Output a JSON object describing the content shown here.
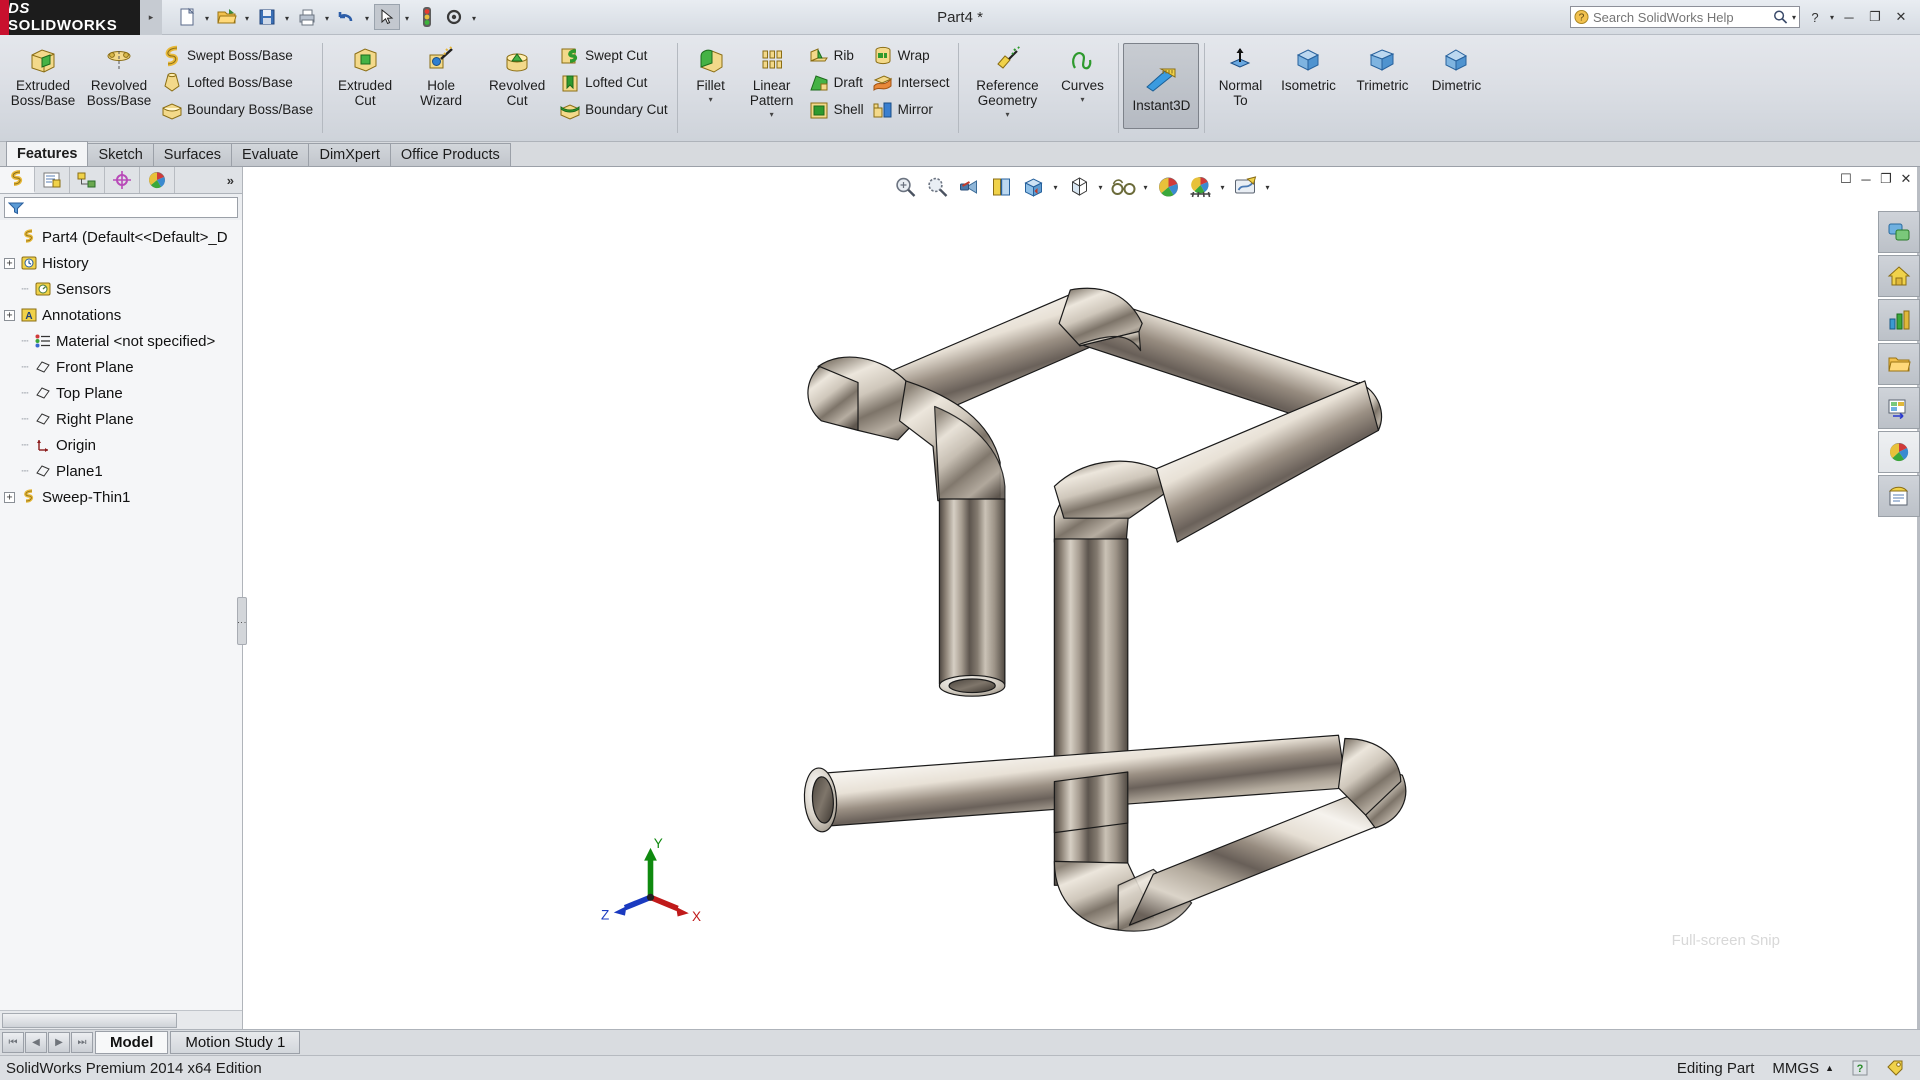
{
  "app": {
    "logo_text_ds": "DS",
    "logo_text_name": "SOLIDWORKS",
    "title": "Part4 *"
  },
  "quick_access": {
    "buttons": [
      {
        "name": "new-document",
        "icon": "new-file-icon"
      },
      {
        "name": "open-document",
        "icon": "open-folder-icon"
      },
      {
        "name": "save-document",
        "icon": "save-disk-icon"
      },
      {
        "name": "print-document",
        "icon": "printer-icon"
      },
      {
        "name": "undo",
        "icon": "undo-arrow-icon"
      },
      {
        "name": "select",
        "icon": "cursor-arrow-icon"
      },
      {
        "name": "rebuild",
        "icon": "traffic-light-icon"
      },
      {
        "name": "options",
        "icon": "gear-icon"
      }
    ]
  },
  "search": {
    "placeholder": "Search SolidWorks Help",
    "value": ""
  },
  "window_controls": {
    "help": "?",
    "minimize": "─",
    "restore": "❐",
    "close": "✕"
  },
  "ribbon": {
    "groups": [
      {
        "name": "boss-base",
        "big": [
          {
            "label": "Extruded\nBoss/Base",
            "icon": "extruded-boss-icon"
          },
          {
            "label": "Revolved\nBoss/Base",
            "icon": "revolved-boss-icon"
          }
        ],
        "small": [
          {
            "label": "Swept Boss/Base",
            "icon": "swept-boss-icon"
          },
          {
            "label": "Lofted Boss/Base",
            "icon": "lofted-boss-icon"
          },
          {
            "label": "Boundary Boss/Base",
            "icon": "boundary-boss-icon"
          }
        ]
      },
      {
        "name": "cut",
        "big": [
          {
            "label": "Extruded\nCut",
            "icon": "extruded-cut-icon"
          },
          {
            "label": "Hole\nWizard",
            "icon": "hole-wizard-icon"
          },
          {
            "label": "Revolved\nCut",
            "icon": "revolved-cut-icon"
          }
        ],
        "small": [
          {
            "label": "Swept Cut",
            "icon": "swept-cut-icon"
          },
          {
            "label": "Lofted Cut",
            "icon": "lofted-cut-icon"
          },
          {
            "label": "Boundary Cut",
            "icon": "boundary-cut-icon"
          }
        ]
      },
      {
        "name": "features",
        "big": [
          {
            "label": "Fillet",
            "icon": "fillet-icon",
            "caret": true
          },
          {
            "label": "Linear\nPattern",
            "icon": "linear-pattern-icon",
            "caret": true
          }
        ],
        "small": [
          {
            "label": "Rib",
            "icon": "rib-icon"
          },
          {
            "label": "Draft",
            "icon": "draft-icon"
          },
          {
            "label": "Shell",
            "icon": "shell-icon"
          }
        ],
        "small2": [
          {
            "label": "Wrap",
            "icon": "wrap-icon"
          },
          {
            "label": "Intersect",
            "icon": "intersect-icon"
          },
          {
            "label": "Mirror",
            "icon": "mirror-icon"
          }
        ]
      },
      {
        "name": "reference",
        "big": [
          {
            "label": "Reference\nGeometry",
            "icon": "reference-geometry-icon",
            "caret": true
          },
          {
            "label": "Curves",
            "icon": "curves-icon",
            "caret": true
          }
        ]
      },
      {
        "name": "instant3d",
        "big": [
          {
            "label": "Instant3D",
            "icon": "instant3d-icon",
            "selected": true
          }
        ]
      },
      {
        "name": "view-orientation",
        "big": [
          {
            "label": "Normal\nTo",
            "icon": "normal-to-icon"
          },
          {
            "label": "Isometric",
            "icon": "isometric-cube-icon"
          },
          {
            "label": "Trimetric",
            "icon": "trimetric-cube-icon"
          },
          {
            "label": "Dimetric",
            "icon": "dimetric-cube-icon"
          }
        ]
      }
    ]
  },
  "command_tabs": [
    {
      "label": "Features",
      "active": true
    },
    {
      "label": "Sketch",
      "active": false
    },
    {
      "label": "Surfaces",
      "active": false
    },
    {
      "label": "Evaluate",
      "active": false
    },
    {
      "label": "DimXpert",
      "active": false
    },
    {
      "label": "Office Products",
      "active": false
    }
  ],
  "feature_manager": {
    "tabs": [
      {
        "name": "feature-manager-design-tree-tab",
        "icon": "feature-tree-icon",
        "active": true
      },
      {
        "name": "property-manager-tab",
        "icon": "property-manager-icon",
        "active": false
      },
      {
        "name": "configuration-manager-tab",
        "icon": "configuration-manager-icon",
        "active": false
      },
      {
        "name": "dimxpert-manager-tab",
        "icon": "dimxpert-manager-icon",
        "active": false
      },
      {
        "name": "display-manager-tab",
        "icon": "display-manager-icon",
        "active": false
      }
    ],
    "more_label": "»",
    "filter_placeholder": "",
    "tree": [
      {
        "label": "Part4  (Default<<Default>_D",
        "icon": "part-icon",
        "expander": "",
        "indent": 0
      },
      {
        "label": "History",
        "icon": "history-icon",
        "expander": "+",
        "indent": 1
      },
      {
        "label": "Sensors",
        "icon": "sensors-icon",
        "expander": "",
        "indent": 1
      },
      {
        "label": "Annotations",
        "icon": "annotations-icon",
        "expander": "+",
        "indent": 1
      },
      {
        "label": "Material <not specified>",
        "icon": "material-icon",
        "expander": "",
        "indent": 1
      },
      {
        "label": "Front Plane",
        "icon": "plane-icon",
        "expander": "",
        "indent": 1
      },
      {
        "label": "Top Plane",
        "icon": "plane-icon",
        "expander": "",
        "indent": 1
      },
      {
        "label": "Right Plane",
        "icon": "plane-icon",
        "expander": "",
        "indent": 1
      },
      {
        "label": "Origin",
        "icon": "origin-icon",
        "expander": "",
        "indent": 1
      },
      {
        "label": "Plane1",
        "icon": "plane-icon",
        "expander": "",
        "indent": 1
      },
      {
        "label": "Sweep-Thin1",
        "icon": "sweep-icon",
        "expander": "+",
        "indent": 1
      }
    ]
  },
  "heads_up_view": {
    "buttons": [
      {
        "name": "zoom-to-fit-button",
        "icon": "zoom-to-fit-icon"
      },
      {
        "name": "zoom-to-area-button",
        "icon": "zoom-to-area-icon"
      },
      {
        "name": "previous-view-button",
        "icon": "previous-view-icon"
      },
      {
        "name": "section-view-button",
        "icon": "section-view-icon"
      },
      {
        "name": "view-orientation-button",
        "icon": "view-orientation-icon",
        "caret": true
      },
      {
        "name": "display-style-button",
        "icon": "display-style-icon",
        "caret": true
      },
      {
        "name": "hide-show-items-button",
        "icon": "hide-show-glasses-icon",
        "caret": true
      },
      {
        "name": "edit-appearance-button",
        "icon": "appearance-ball-icon"
      },
      {
        "name": "apply-scene-button",
        "icon": "scene-icon",
        "caret": true
      },
      {
        "name": "view-settings-button",
        "icon": "view-settings-icon",
        "caret": true
      }
    ]
  },
  "graphics": {
    "triad_labels": {
      "x": "X",
      "y": "Y",
      "z": "Z"
    },
    "watermark": "Full-screen Snip",
    "model_name": "Sweep-Thin1",
    "colors": {
      "metal_light": "#f2efe9",
      "metal_mid": "#8f867b",
      "metal_dark": "#4a443d",
      "outline": "#1a1a1a",
      "background": "#ffffff"
    }
  },
  "task_pane": [
    {
      "name": "solidworks-resources-button",
      "icon": "resources-icon",
      "active": false
    },
    {
      "name": "design-library-button",
      "icon": "home-library-icon",
      "active": false
    },
    {
      "name": "file-explorer-button",
      "icon": "chart-icon",
      "active": false
    },
    {
      "name": "search-button",
      "icon": "folder-icon",
      "active": false
    },
    {
      "name": "view-palette-button",
      "icon": "view-palette-icon",
      "active": false
    },
    {
      "name": "appearances-scenes-button",
      "icon": "appearances-ball-icon",
      "active": true
    },
    {
      "name": "custom-properties-button",
      "icon": "custom-properties-icon",
      "active": false
    }
  ],
  "bottom_tabs": {
    "nav": [
      "⏮",
      "◀",
      "▶",
      "⏭"
    ],
    "tabs": [
      {
        "label": "Model",
        "active": true
      },
      {
        "label": "Motion Study 1",
        "active": false
      }
    ]
  },
  "status_bar": {
    "left": "SolidWorks Premium 2014 x64 Edition",
    "editing": "Editing Part",
    "units": "MMGS",
    "units_caret": "▲",
    "help_badge": "?",
    "tag_icon": "tag-icon"
  }
}
